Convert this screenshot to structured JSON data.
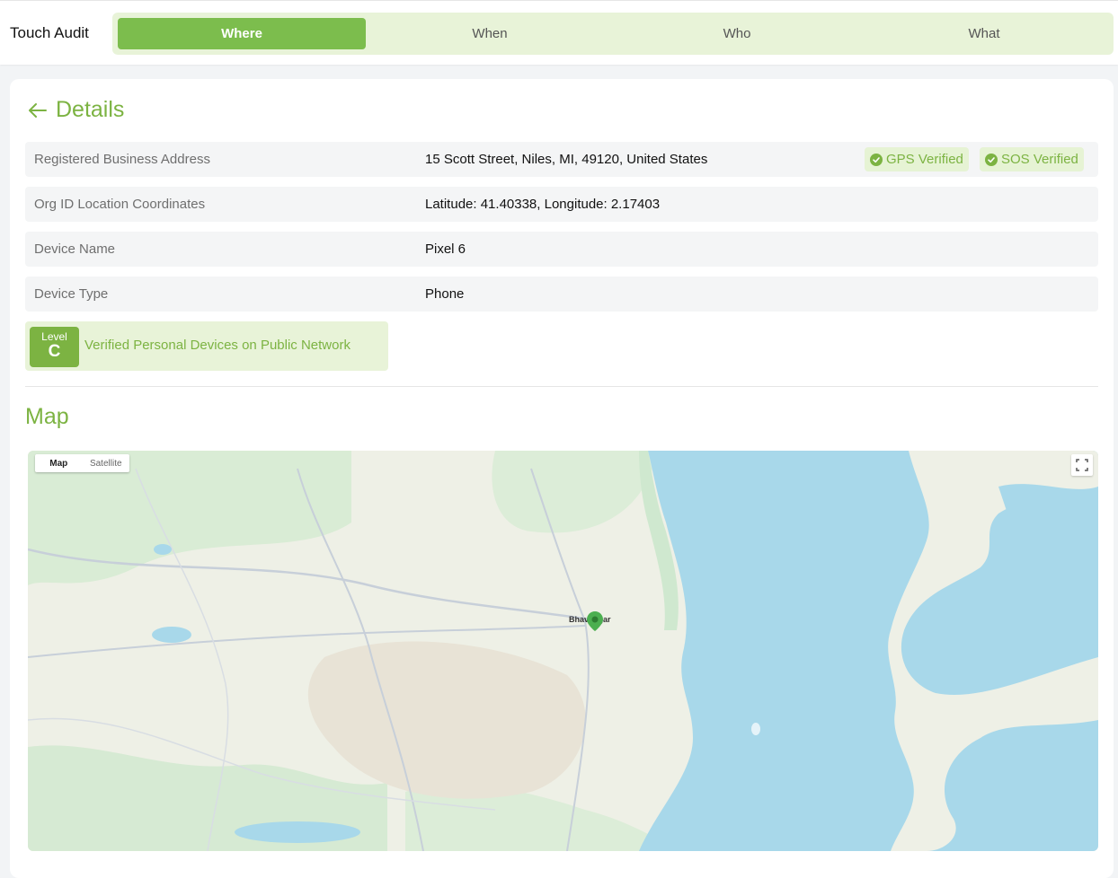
{
  "app": {
    "title": "Touch Audit"
  },
  "tabs": [
    {
      "label": "Where",
      "active": true
    },
    {
      "label": "When",
      "active": false
    },
    {
      "label": "Who",
      "active": false
    },
    {
      "label": "What",
      "active": false
    }
  ],
  "details": {
    "title": "Details",
    "rows": [
      {
        "label": "Registered Business Address",
        "value": "15 Scott Street, Niles, MI, 49120, United States"
      },
      {
        "label": "Org ID Location Coordinates",
        "value": "Latitude: 41.40338, Longitude: 2.17403"
      },
      {
        "label": "Device Name",
        "value": "Pixel 6"
      },
      {
        "label": "Device Type",
        "value": "Phone"
      }
    ],
    "badges": [
      {
        "label": "GPS Verified",
        "icon": "check-circle-icon"
      },
      {
        "label": "SOS Verified",
        "icon": "check-circle-icon"
      }
    ],
    "level": {
      "label": "Level",
      "value": "C",
      "description": "Verified Personal Devices on Public Network"
    }
  },
  "map": {
    "title": "Map",
    "type_options": [
      "Map",
      "Satellite"
    ],
    "selected_type": "Map",
    "city": "Bhavnagar"
  },
  "colors": {
    "accent": "#7cb342",
    "tab_active": "#7cbd4d",
    "tab_bg": "#e8f3d8",
    "water": "#a8d8ea",
    "land": "#eef0e6"
  }
}
